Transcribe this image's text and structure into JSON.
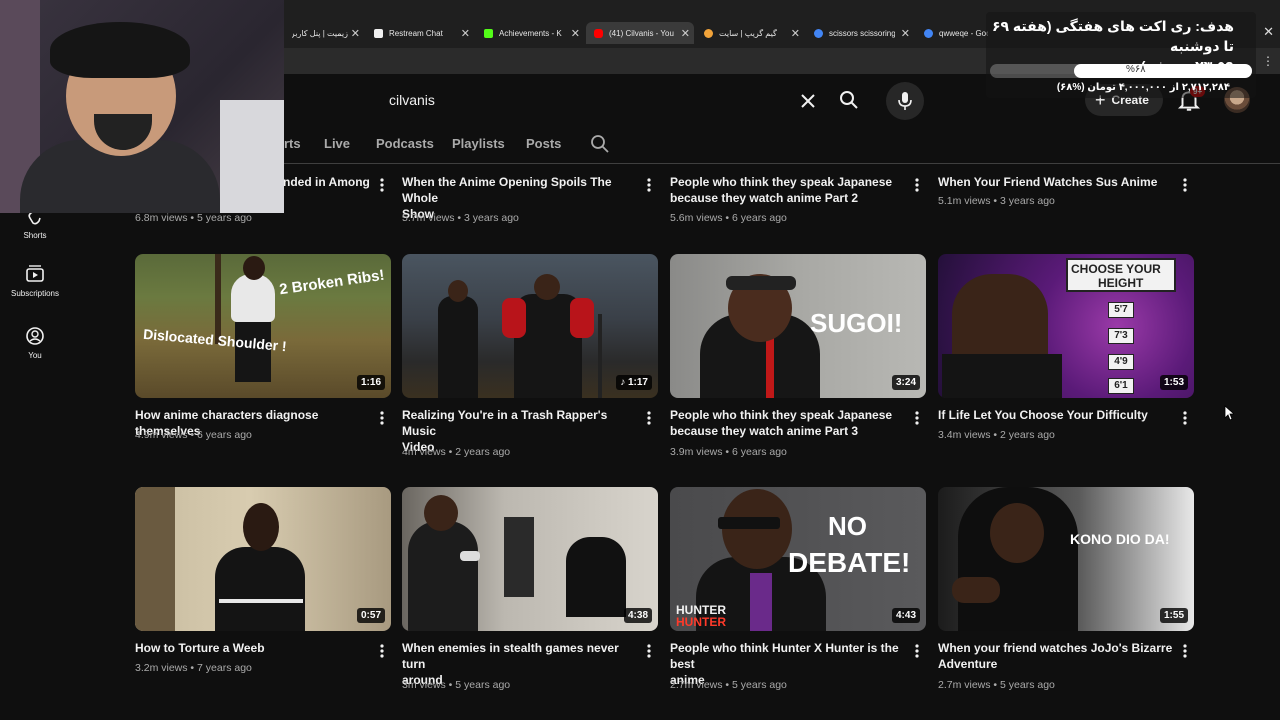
{
  "browser": {
    "tabs": [
      {
        "label": "زیمیت | پنل کاربری",
        "favicon_color": "#3a3a3a"
      },
      {
        "label": "Restream Chat",
        "favicon_color": "#f0f0f0"
      },
      {
        "label": "Achievements - K",
        "favicon_color": "#53fc18"
      },
      {
        "label": "(41) Cilvanis - You",
        "favicon_color": "#ff0000"
      },
      {
        "label": "گیم گریپ | سایت",
        "favicon_color": "#f1a33a"
      },
      {
        "label": "scissors scissoring",
        "favicon_color": "#4285f4"
      },
      {
        "label": "qwweqe - Goog",
        "favicon_color": "#4285f4"
      }
    ]
  },
  "header": {
    "search_value": "cilvanis",
    "create_label": "Create",
    "notification_count": "9+"
  },
  "channel_tabs": {
    "items": [
      "rts",
      "Live",
      "Podcasts",
      "Playlists",
      "Posts"
    ]
  },
  "sidebar": {
    "items": [
      {
        "label": "Shorts",
        "icon": "shorts-icon"
      },
      {
        "label": "Subscriptions",
        "icon": "subscriptions-icon"
      },
      {
        "label": "You",
        "icon": "you-icon"
      }
    ]
  },
  "videos": {
    "row1": [
      {
        "title_line1": "nded in Among",
        "title_line2": "",
        "meta": "6.8m views • 5 years ago"
      },
      {
        "title_line1": "When the Anime Opening Spoils The Whole",
        "title_line2": "Show",
        "meta": "5.7m views • 3 years ago"
      },
      {
        "title_line1": "People who think they speak Japanese",
        "title_line2": "because they watch anime Part 2",
        "meta": "5.6m views • 6 years ago"
      },
      {
        "title_line1": "When Your Friend Watches Sus Anime",
        "title_line2": "",
        "meta": "5.1m views • 3 years ago"
      }
    ],
    "row2": [
      {
        "title_line1": "How anime characters diagnose themselves",
        "title_line2": "",
        "meta": "4.9m views • 6 years ago",
        "duration": "1:16",
        "overlay1": "2 Broken Ribs!",
        "overlay2": "Dislocated Shoulder !"
      },
      {
        "title_line1": "Realizing You're in a Trash Rapper's Music",
        "title_line2": "Video",
        "meta": "4m views • 2 years ago",
        "duration": "♪ 1:17"
      },
      {
        "title_line1": "People who think they speak Japanese",
        "title_line2": "because they watch anime Part 3",
        "meta": "3.9m views • 6 years ago",
        "duration": "3:24",
        "overlay1": "SUGOI!"
      },
      {
        "title_line1": "If Life Let You Choose Your Difficulty",
        "title_line2": "",
        "meta": "3.4m views • 2 years ago",
        "duration": "1:53",
        "overlay1": "CHOOSE YOUR",
        "overlay2": "HEIGHT",
        "heights": [
          "5'7",
          "7'3",
          "4'9",
          "6'1"
        ]
      }
    ],
    "row3": [
      {
        "title_line1": "How to Torture a Weeb",
        "title_line2": "",
        "meta": "3.2m views • 7 years ago",
        "duration": "0:57"
      },
      {
        "title_line1": "When enemies in stealth games never turn",
        "title_line2": "around",
        "meta": "3m views • 5 years ago",
        "duration": "4:38"
      },
      {
        "title_line1": "People who think Hunter X Hunter is the best",
        "title_line2": "anime",
        "meta": "2.7m views • 5 years ago",
        "duration": "4:43",
        "overlay1": "NO",
        "overlay2": "DEBATE!",
        "overlay3": "HUNTER",
        "overlay4": "HUNTER"
      },
      {
        "title_line1": "When your friend watches JoJo's Bizarre",
        "title_line2": "Adventure",
        "meta": "2.7m views • 5 years ago",
        "duration": "1:55",
        "overlay1": "KONO DIO DA!"
      }
    ]
  },
  "stream_overlay": {
    "goal_title_line1": "هدف: ری اکت های هفتگی (هفته ۶۹ تا دوشنبه",
    "goal_title_line2": "۲۳:۵۹ پر بشه)",
    "goal_percent": "%۶۸",
    "goal_progress": 0.68,
    "goal_amount": "۲,۷۱۲,۲۸۴ از ۴,۰۰۰,۰۰۰ تومان (%۶۸)"
  }
}
